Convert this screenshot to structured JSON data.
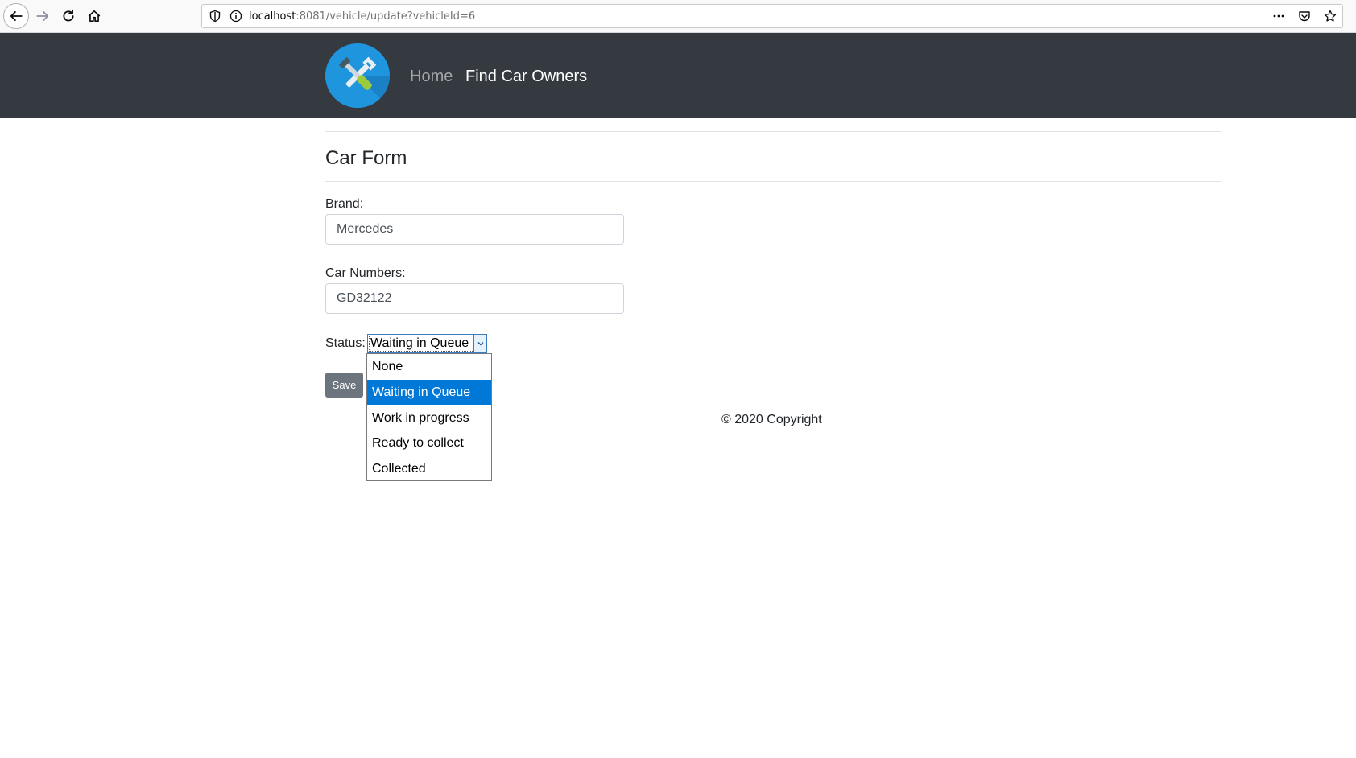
{
  "browser": {
    "url_host": "localhost",
    "url_rest": ":8081/vehicle/update?vehicleId=6"
  },
  "navbar": {
    "logo_icon": "tools-icon",
    "home_label": "Home",
    "find_owners_label": "Find Car Owners"
  },
  "form": {
    "title": "Car Form",
    "brand_label": "Brand:",
    "brand_value": "Mercedes",
    "numbers_label": "Car Numbers:",
    "numbers_value": "GD32122",
    "status_label": "Status:",
    "status_value": "Waiting in Queue",
    "status_options": [
      "None",
      "Waiting in Queue",
      "Work in progress",
      "Ready to collect",
      "Collected"
    ],
    "save_label": "Save"
  },
  "footer": {
    "copyright": "© 2020 Copyright"
  },
  "colors": {
    "navbar_bg": "#343a40",
    "selected_option": "#0078d7",
    "save_button": "#6c757d"
  }
}
